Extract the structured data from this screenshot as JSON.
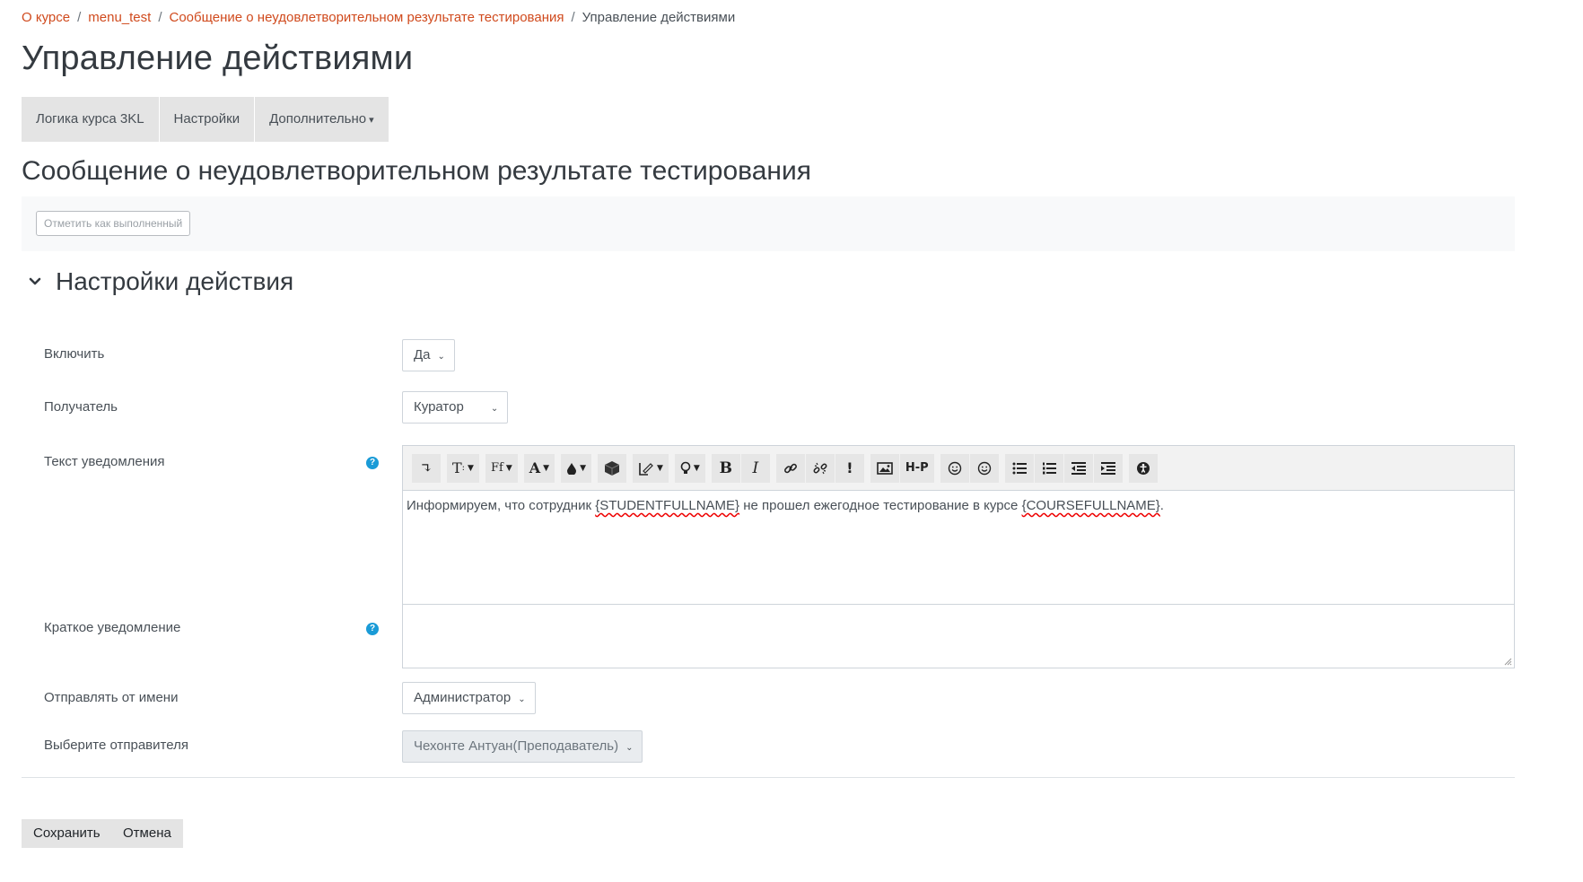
{
  "breadcrumb": {
    "items": [
      "О курсе",
      "menu_test",
      "Сообщение о неудовлетворительном результате тестирования"
    ],
    "current": "Управление действиями",
    "separator": "/"
  },
  "page_title": "Управление действиями",
  "tabs": [
    {
      "label": "Логика курса 3KL"
    },
    {
      "label": "Настройки"
    },
    {
      "label": "Дополнительно"
    }
  ],
  "activity_title": "Сообщение о неудовлетворительном результате тестирования",
  "completion_button": "Отметить как выполненный",
  "section_title": "Настройки действия",
  "form": {
    "enable": {
      "label": "Включить",
      "value": "Да"
    },
    "recipient": {
      "label": "Получатель",
      "value": "Куратор"
    },
    "notification_text": {
      "label": "Текст уведомления",
      "content": {
        "part1": "Информируем, что сотрудник ",
        "token1": "{STUDENTFULLNAME}",
        "part2": " не прошел ежегодное тестирование в курсе ",
        "token2": "{COURSEFULLNAME}",
        "part3": "."
      }
    },
    "short_notification": {
      "label": "Краткое уведомление",
      "value": ""
    },
    "send_as": {
      "label": "Отправлять от имени",
      "value": "Администратор"
    },
    "sender": {
      "label": "Выберите отправителя",
      "value": "Чехонте Антуан(Преподаватель)"
    }
  },
  "toolbar_buttons": [
    "collapse-icon",
    "font-size-icon",
    "font-family-icon",
    "font-color-icon",
    "background-color-icon",
    "cube-icon",
    "style-icon",
    "lightbulb-icon",
    "bold-icon",
    "italic-icon",
    "link-icon",
    "unlink-icon",
    "exclamation-icon",
    "image-icon",
    "h5p-icon",
    "emoji-icon",
    "emoji-alt-icon",
    "unordered-list-icon",
    "ordered-list-icon",
    "outdent-icon",
    "indent-icon",
    "accessibility-icon"
  ],
  "toolbar_labels": {
    "font_family": "Ff",
    "h5p": "H-P",
    "bold": "B",
    "italic": "I",
    "exclaim": "!",
    "font_color": "A"
  },
  "buttons": {
    "save": "Сохранить",
    "cancel": "Отмена"
  },
  "colors": {
    "link": "#d04a1d",
    "help": "#1a9bd7",
    "tab_bg": "#e4e4e4"
  }
}
